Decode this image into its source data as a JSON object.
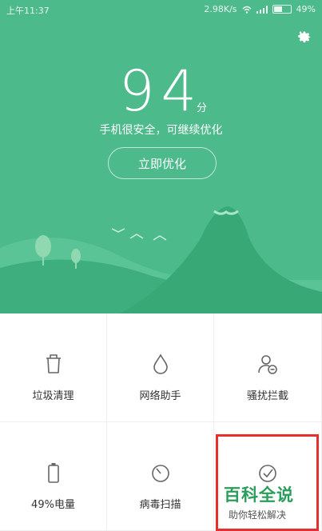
{
  "status_bar": {
    "time": "上午11:37",
    "speed": "2.98K/s",
    "battery": "49%",
    "battery_level": 0.49
  },
  "hero": {
    "score": "94",
    "unit": "分",
    "status_text": "手机很安全，可继续优化",
    "optimize_button": "立即优化"
  },
  "colors": {
    "hero_bg": "#4dba8b",
    "accent_green": "#2a9d5c",
    "highlight_red": "#e5302d"
  },
  "grid": {
    "items": [
      {
        "label": "垃圾清理",
        "icon": "trash-icon"
      },
      {
        "label": "网络助手",
        "icon": "droplet-icon"
      },
      {
        "label": "骚扰拦截",
        "icon": "user-block-icon"
      },
      {
        "label": "49%电量",
        "icon": "battery-icon"
      },
      {
        "label": "病毒扫描",
        "icon": "scan-clock-icon"
      },
      {
        "label": "",
        "icon": "check-circle-icon"
      }
    ]
  },
  "watermark": {
    "title": "百科全说",
    "subtitle": "助你轻松解决"
  }
}
